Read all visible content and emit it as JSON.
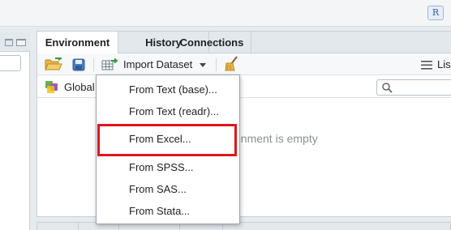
{
  "colors": {
    "highlight": "#e0141c",
    "accent_green": "#3a9a3a",
    "accent_blue": "#2f6fb3"
  },
  "window": {
    "project_icon": "r-project-icon",
    "project_glyph": "R"
  },
  "env_pane": {
    "tabs": [
      {
        "label": "Environment",
        "active": true
      },
      {
        "label": "History",
        "active": false
      },
      {
        "label": "Connections",
        "active": false
      }
    ],
    "toolbar": {
      "import_label": "Import Dataset",
      "list_label": "Lis",
      "icons": [
        "open-folder-icon",
        "save-icon",
        "import-dataset-icon",
        "chevron-down-icon",
        "broom-icon",
        "list-icon"
      ]
    },
    "scope_label": "Global",
    "empty_message": "onment is empty"
  },
  "import_menu": {
    "items": [
      "From Text (base)...",
      "From Text (readr)...",
      "From Excel...",
      "From SPSS...",
      "From SAS...",
      "From Stata..."
    ],
    "highlighted": "From Excel..."
  }
}
